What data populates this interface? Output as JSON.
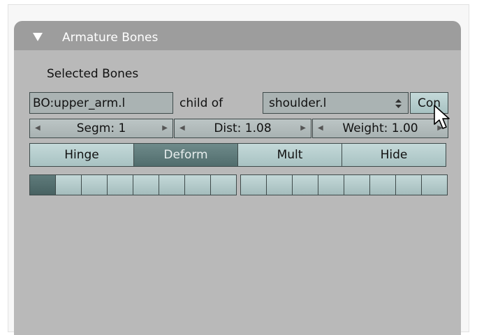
{
  "panel": {
    "title": "Armature Bones"
  },
  "section_label": "Selected Bones",
  "bone_name": "BO:upper_arm.l",
  "child_of_label": "child of",
  "parent_select": "shoulder.l",
  "connect_button": "Con",
  "segm_field": "Segm: 1",
  "dist_field": "Dist: 1.08",
  "weight_field": "Weight: 1.00",
  "toggles": {
    "hinge": "Hinge",
    "deform": "Deform",
    "mult": "Mult",
    "hide": "Hide"
  },
  "layer_group_1": {
    "count": 8,
    "active": [
      1
    ]
  },
  "layer_group_2": {
    "count": 8,
    "active": []
  },
  "colors": {
    "panel_bg": "#b9b9b9",
    "header_bg": "#9d9d9d",
    "button": "#b6cccc",
    "button_active": "#5f7b7b"
  },
  "icons": [
    "collapse-triangle-icon",
    "updown-arrows-icon",
    "left-arrow-icon",
    "right-arrow-icon",
    "mouse-pointer-icon"
  ]
}
